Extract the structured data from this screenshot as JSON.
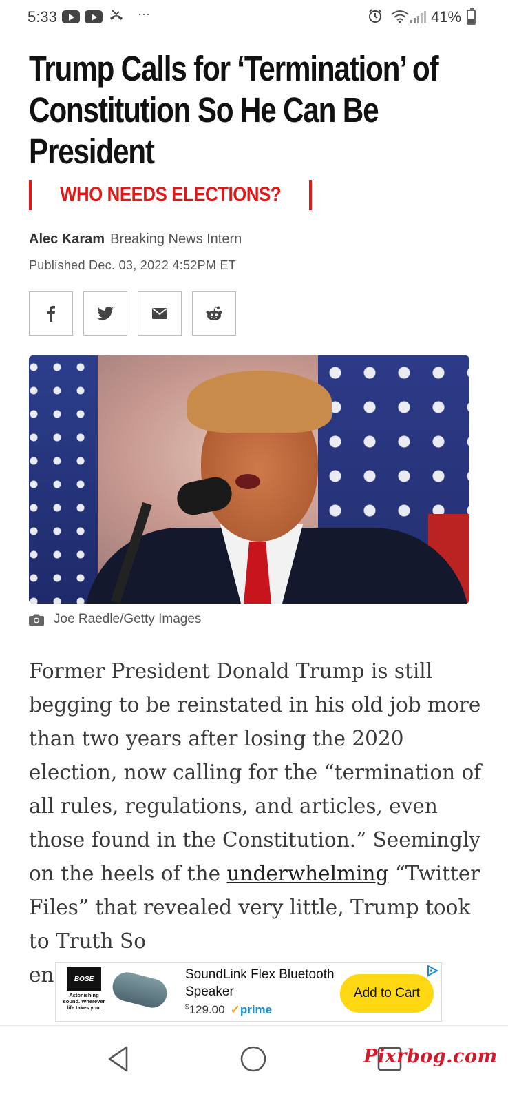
{
  "status_bar": {
    "time": "5:33",
    "icons": [
      "youtube-icon",
      "youtube-icon",
      "missed-call-icon",
      "more-dots-icon",
      "alarm-icon",
      "wifi-icon",
      "signal-icon",
      "battery-icon"
    ],
    "dots": "···",
    "battery_percent": "41%",
    "battery_level": 0.41
  },
  "article": {
    "headline": "Trump Calls for ‘Termination’ of Constitution So He Can Be President",
    "rubric": "WHO NEEDS ELECTIONS?",
    "author": "Alec Karam",
    "author_role": "Breaking News Intern",
    "published": "Published Dec. 03, 2022 4:52PM ET",
    "share_icons": [
      "facebook-icon",
      "twitter-icon",
      "email-icon",
      "reddit-icon"
    ],
    "photo_credit": "Joe Raedle/Getty Images",
    "body_part1": "Former President Donald Trump is still begging to be reinstated in his old job more than two years after losing the 2020 election, now calling for the “termination of all rules, regulations, and articles, even those found in the Constitution.” Seemingly on the heels of the ",
    "body_link": "underwhelming",
    "body_part2": " “Twitter Files” that revealed very little, Trump took to Truth So",
    "body_part3": "en"
  },
  "ad": {
    "brand": "BOSE",
    "brand_tagline": "Astonishing sound. Wherever life takes you.",
    "product_title": "SoundLink Flex Bluetooth Speaker",
    "currency": "$",
    "price": "129.00",
    "prime_label": "prime",
    "cta": "Add to Cart",
    "colors": {
      "cta": "#ffd814",
      "prime": "#1a8fd6"
    }
  },
  "nav_bar": {
    "buttons": [
      "back-icon",
      "home-icon",
      "recents-icon"
    ]
  },
  "watermark": "Pixrbog.com",
  "colors": {
    "accent_red": "#e01818",
    "headline": "#111111",
    "body_text": "#3a3a3a"
  }
}
